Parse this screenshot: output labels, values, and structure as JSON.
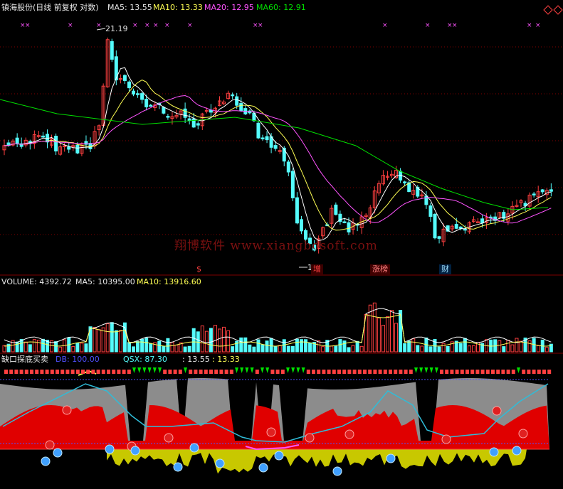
{
  "header": {
    "title": "镇海股份(日线 前复权 对数)",
    "ma5_label": "MA5: 13.55",
    "ma10_label": "MA10: 13.33",
    "ma20_label": "MA20: 12.95",
    "ma60_label": "MA60: 12.91"
  },
  "price_annotations": {
    "high_label": "21.19",
    "low_label": "13",
    "markers": [
      "$",
      "增",
      "涨榜",
      "财"
    ]
  },
  "watermark": "翔博软件 www.xiangbosoft.com",
  "volume_header": {
    "label": "VOLUME: 4392.72",
    "ma5_label": "MA5: 10395.00",
    "ma10_label": "MA10: 13916.60"
  },
  "indicator_header": {
    "title": "缺口探底买卖",
    "db_label": "DB: 100.00",
    "qsx_label": "QSX: 87.30",
    "val1": ": 13.55",
    "val2": ": 13.33"
  },
  "colors": {
    "bg": "#000000",
    "up": "#ff4040",
    "down": "#54fcfc",
    "ma5": "#ffffff",
    "ma10": "#ffff54",
    "ma20": "#ff54ff",
    "ma60": "#00e000",
    "gray_area": "#8c8c8c",
    "red_area": "#e00000",
    "yellow_area": "#c8c800",
    "grid": "#800000"
  },
  "chart_data": {
    "type": "candlestick",
    "log_scale": true,
    "price_high": 21.19,
    "price_low": 13,
    "segments": [
      {
        "phase": "rally",
        "note": "price rises from ~16 to peak 21.19"
      },
      {
        "phase": "decline",
        "note": "falls to low 13"
      },
      {
        "phase": "rebound",
        "note": "rebound near 涨榜 marker"
      },
      {
        "phase": "recovery",
        "note": "gradual recovery to ~13.5"
      }
    ],
    "series_names": [
      "MA5",
      "MA10",
      "MA20",
      "MA60"
    ]
  }
}
